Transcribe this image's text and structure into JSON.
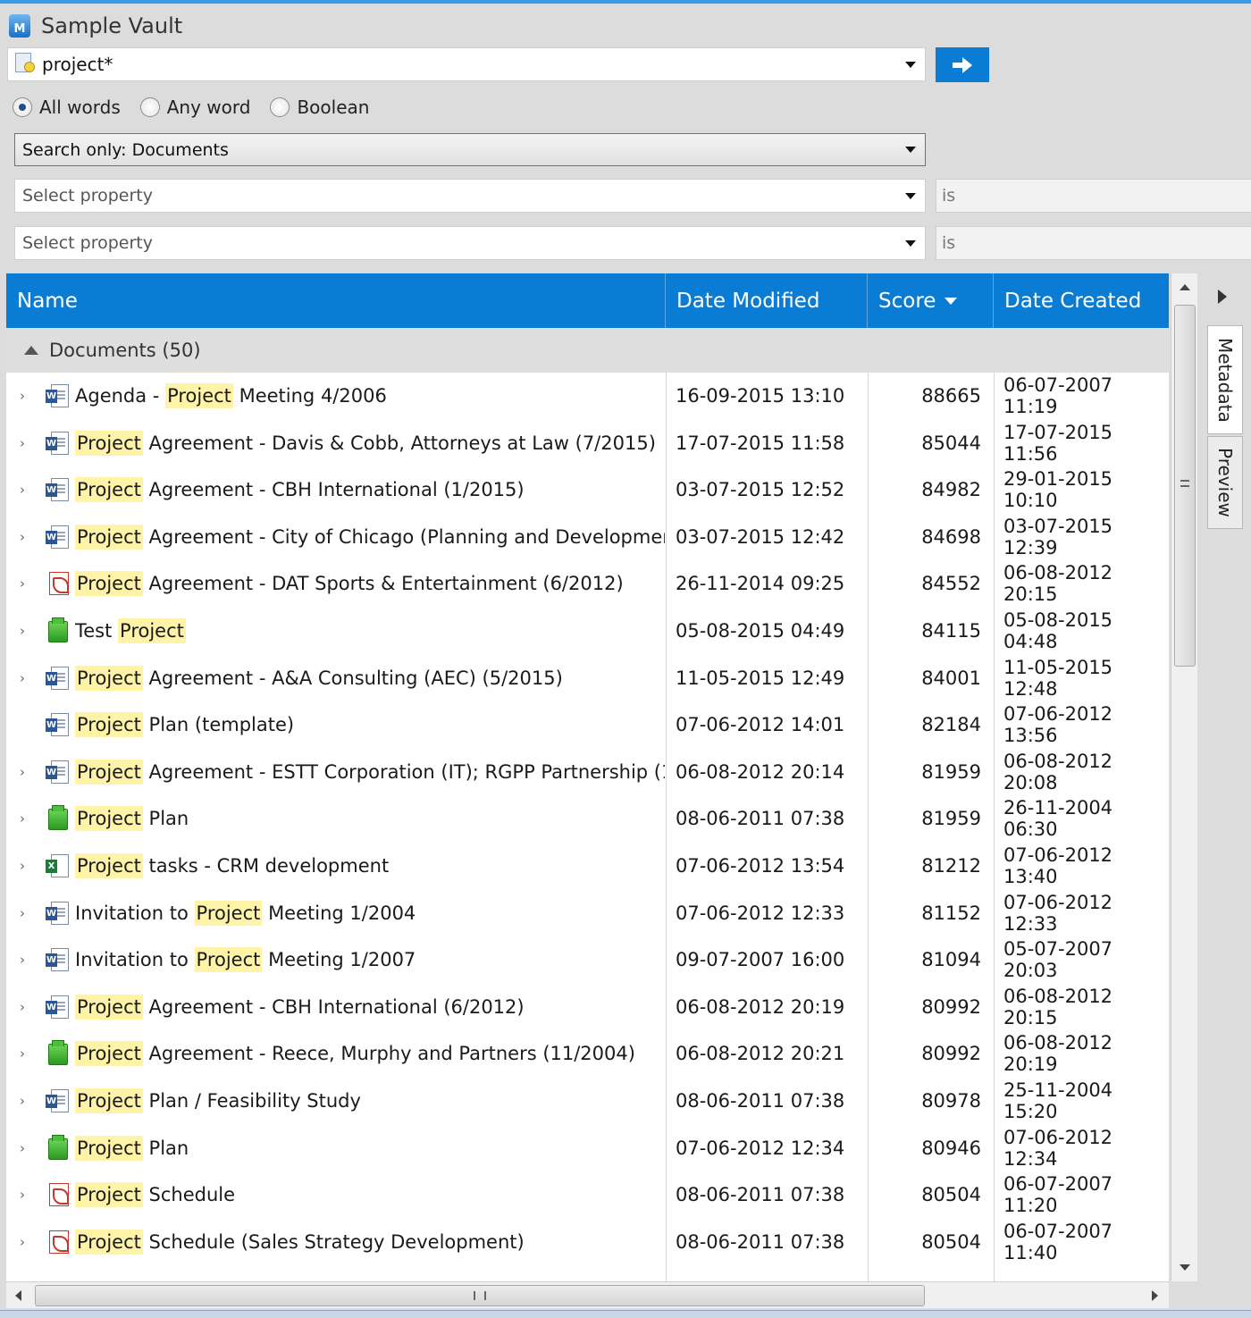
{
  "app": {
    "title": "Sample Vault",
    "icon_letter": "M"
  },
  "search": {
    "value": "project*",
    "go_icon": "arrow-right-icon"
  },
  "search_mode": {
    "options": [
      "All words",
      "Any word",
      "Boolean"
    ],
    "selected": "All words"
  },
  "search_only": {
    "label": "Search only: Documents"
  },
  "property_filters": [
    {
      "placeholder": "Select property",
      "operator": "is"
    },
    {
      "placeholder": "Select property",
      "operator": "is"
    }
  ],
  "columns": {
    "name": "Name",
    "date_modified": "Date Modified",
    "score": "Score",
    "date_created": "Date Created",
    "sorted_by": "Score",
    "sort_direction": "descending"
  },
  "group": {
    "label": "Documents (50)"
  },
  "rows": [
    {
      "icon": "word",
      "pre": "Agenda - ",
      "hl": "Project",
      "post": " Meeting 4/2006",
      "date_modified": "16-09-2015 13:10",
      "score": "88665",
      "date_created": "06-07-2007 11:19"
    },
    {
      "icon": "word",
      "pre": "",
      "hl": "Project",
      "post": " Agreement - Davis & Cobb, Attorneys at Law (7/2015)",
      "date_modified": "17-07-2015 11:58",
      "score": "85044",
      "date_created": "17-07-2015 11:56"
    },
    {
      "icon": "word",
      "pre": "",
      "hl": "Project",
      "post": " Agreement - CBH International (1/2015)",
      "date_modified": "03-07-2015 12:52",
      "score": "84982",
      "date_created": "29-01-2015 10:10"
    },
    {
      "icon": "word",
      "pre": "",
      "hl": "Project",
      "post": " Agreement - City of Chicago (Planning and Developmen...",
      "date_modified": "03-07-2015 12:42",
      "score": "84698",
      "date_created": "03-07-2015 12:39"
    },
    {
      "icon": "pdf",
      "pre": "",
      "hl": "Project",
      "post": " Agreement - DAT Sports & Entertainment (6/2012)",
      "date_modified": "26-11-2014 09:25",
      "score": "84552",
      "date_created": "06-08-2012 20:15"
    },
    {
      "icon": "document",
      "pre": "Test ",
      "hl": "Project",
      "post": "",
      "date_modified": "05-08-2015 04:49",
      "score": "84115",
      "date_created": "05-08-2015 04:48"
    },
    {
      "icon": "word",
      "pre": "",
      "hl": "Project",
      "post": " Agreement - A&A Consulting (AEC) (5/2015)",
      "date_modified": "11-05-2015 12:49",
      "score": "84001",
      "date_created": "11-05-2015 12:48"
    },
    {
      "icon": "word",
      "pre": "",
      "hl": "Project",
      "post": " Plan (template)",
      "date_modified": "07-06-2012 14:01",
      "score": "82184",
      "date_created": "07-06-2012 13:56",
      "no_expander": true
    },
    {
      "icon": "word",
      "pre": "",
      "hl": "Project",
      "post": " Agreement - ESTT Corporation (IT); RGPP Partnership (1...",
      "date_modified": "06-08-2012 20:14",
      "score": "81959",
      "date_created": "06-08-2012 20:08"
    },
    {
      "icon": "document",
      "pre": "",
      "hl": "Project",
      "post": " Plan",
      "date_modified": "08-06-2011 07:38",
      "score": "81959",
      "date_created": "26-11-2004 06:30"
    },
    {
      "icon": "excel",
      "pre": "",
      "hl": "Project",
      "post": " tasks - CRM development",
      "date_modified": "07-06-2012 13:54",
      "score": "81212",
      "date_created": "07-06-2012 13:40"
    },
    {
      "icon": "word",
      "pre": "Invitation to ",
      "hl": "Project",
      "post": " Meeting 1/2004",
      "date_modified": "07-06-2012 12:33",
      "score": "81152",
      "date_created": "07-06-2012 12:33"
    },
    {
      "icon": "word",
      "pre": "Invitation to ",
      "hl": "Project",
      "post": " Meeting 1/2007",
      "date_modified": "09-07-2007 16:00",
      "score": "81094",
      "date_created": "05-07-2007 20:03"
    },
    {
      "icon": "word",
      "pre": "",
      "hl": "Project",
      "post": " Agreement - CBH International (6/2012)",
      "date_modified": "06-08-2012 20:19",
      "score": "80992",
      "date_created": "06-08-2012 20:15"
    },
    {
      "icon": "document",
      "pre": "",
      "hl": "Project",
      "post": " Agreement - Reece, Murphy and Partners (11/2004)",
      "date_modified": "06-08-2012 20:21",
      "score": "80992",
      "date_created": "06-08-2012 20:19"
    },
    {
      "icon": "word",
      "pre": "",
      "hl": "Project",
      "post": " Plan / Feasibility Study",
      "date_modified": "08-06-2011 07:38",
      "score": "80978",
      "date_created": "25-11-2004 15:20"
    },
    {
      "icon": "document",
      "pre": "",
      "hl": "Project",
      "post": " Plan",
      "date_modified": "07-06-2012 12:34",
      "score": "80946",
      "date_created": "07-06-2012 12:34"
    },
    {
      "icon": "pdf",
      "pre": "",
      "hl": "Project",
      "post": " Schedule",
      "date_modified": "08-06-2011 07:38",
      "score": "80504",
      "date_created": "06-07-2007 11:20"
    },
    {
      "icon": "pdf",
      "pre": "",
      "hl": "Project",
      "post": " Schedule (Sales Strategy Development)",
      "date_modified": "08-06-2011 07:38",
      "score": "80504",
      "date_created": "06-07-2007 11:40"
    }
  ],
  "side_panel": {
    "tabs": [
      "Metadata",
      "Preview"
    ],
    "active": "Metadata"
  },
  "colors": {
    "accent": "#0b7cd3",
    "highlight": "#fff3a8",
    "background": "#dcdcdc"
  }
}
